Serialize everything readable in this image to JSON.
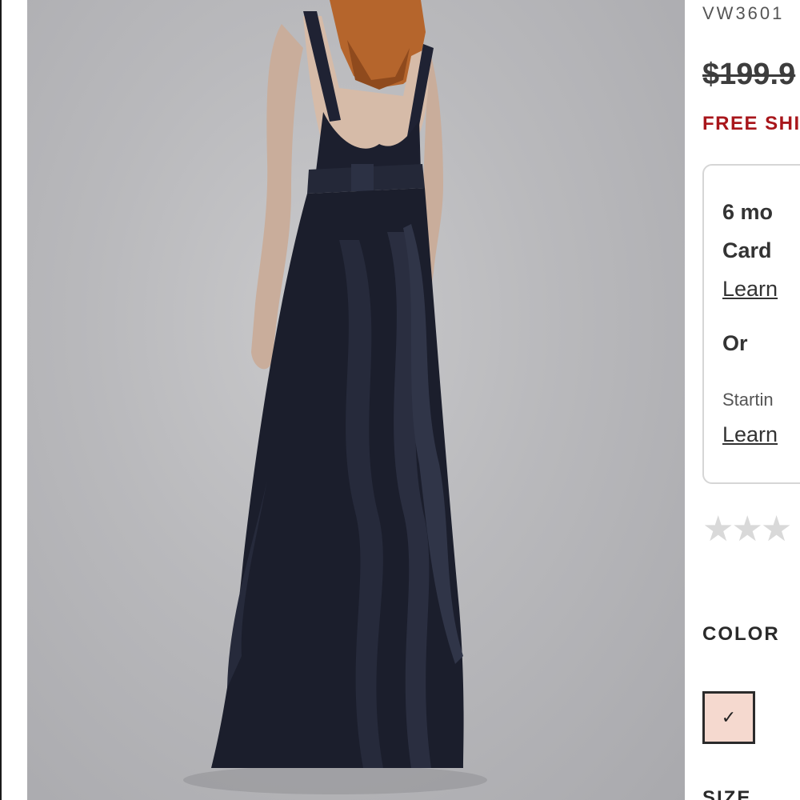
{
  "product": {
    "image_alt": "Navy chiffon gown with ruffled back and satin sash",
    "sku": "VW3601",
    "price": "$199.9",
    "shipping": "FREE SHI"
  },
  "financing": {
    "line1": "6 mo",
    "line2": "Card",
    "link1": "Learn",
    "or_text": "Or",
    "starting": "Startin",
    "link2": "Learn"
  },
  "rating": {
    "stars_glyph": "★★★",
    "value": 0
  },
  "color": {
    "label": "COLOR",
    "selected_swatch": "#f5d9cf",
    "check": "✓"
  },
  "size": {
    "label": "SIZE"
  }
}
